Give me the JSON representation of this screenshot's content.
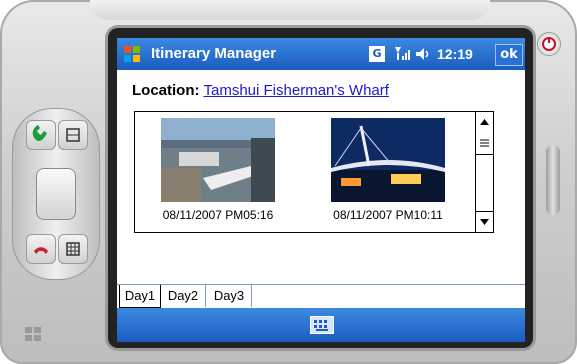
{
  "titlebar": {
    "app_title": "Itinerary Manager",
    "signal_label": "G",
    "time": "12:19",
    "ok_label": "ok"
  },
  "location": {
    "label": "Location:",
    "value": "Tamshui Fisherman's Wharf"
  },
  "photos": [
    {
      "caption": "08/11/2007 PM05:16"
    },
    {
      "caption": "08/11/2007 PM10:11"
    }
  ],
  "tabs": [
    {
      "label": "Day1",
      "active": true
    },
    {
      "label": "Day2",
      "active": false
    },
    {
      "label": "Day3",
      "active": false
    }
  ],
  "icons": {
    "windows": "windows-logo-icon",
    "signal": "signal-icon",
    "volume": "volume-icon",
    "keyboard": "keyboard-icon",
    "call": "call-icon",
    "end_call": "end-call-icon",
    "power": "power-icon"
  },
  "colors": {
    "titlebar_blue": "#1c5cc0",
    "link_blue": "#1a1ad0"
  }
}
